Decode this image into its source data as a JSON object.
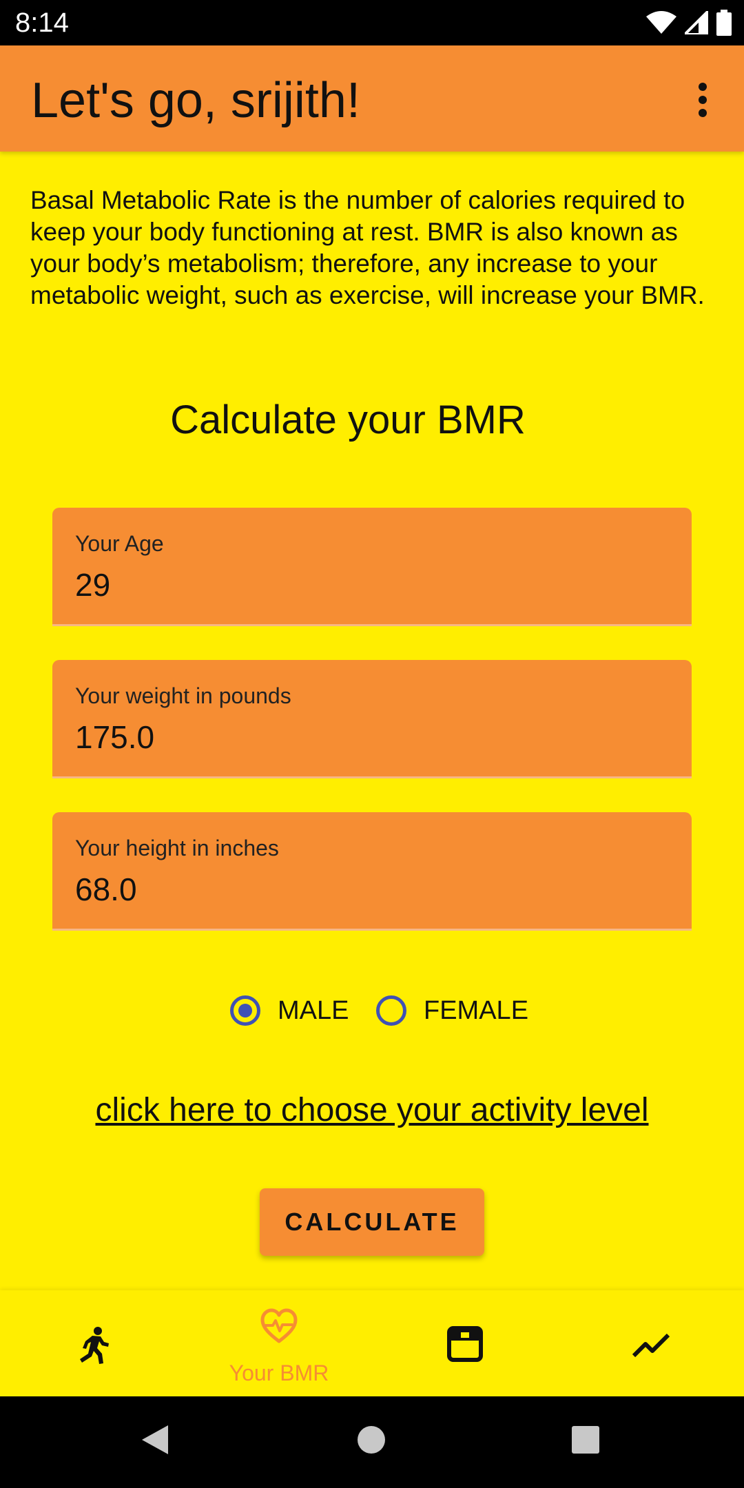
{
  "status_bar": {
    "time": "8:14"
  },
  "app_bar": {
    "title": "Let's go, srijith!",
    "overflow_icon": "more-vert-icon"
  },
  "description": "Basal Metabolic Rate is the number of calories required to keep your body functioning at rest. BMR is also known as your body’s metabolism; therefore, any increase to your metabolic weight, such as exercise, will increase your BMR.",
  "section_title": "Calculate your BMR",
  "fields": [
    {
      "label": "Your Age",
      "value": "29"
    },
    {
      "label": "Your weight in pounds",
      "value": "175.0"
    },
    {
      "label": "Your height in inches",
      "value": "68.0"
    }
  ],
  "gender": {
    "options": [
      "MALE",
      "FEMALE"
    ],
    "selected": "MALE"
  },
  "activity_link": "click here to choose your activity level",
  "calculate_button": "CALCULATE",
  "bottom_nav": [
    {
      "icon": "running-person-icon",
      "label": "",
      "active": false
    },
    {
      "icon": "heart-pulse-icon",
      "label": "Your BMR",
      "active": true
    },
    {
      "icon": "scale-icon",
      "label": "",
      "active": false
    },
    {
      "icon": "trending-line-icon",
      "label": "",
      "active": false
    }
  ],
  "colors": {
    "background": "#FFEE00",
    "accent": "#F68D33",
    "radio": "#3F51B5"
  }
}
